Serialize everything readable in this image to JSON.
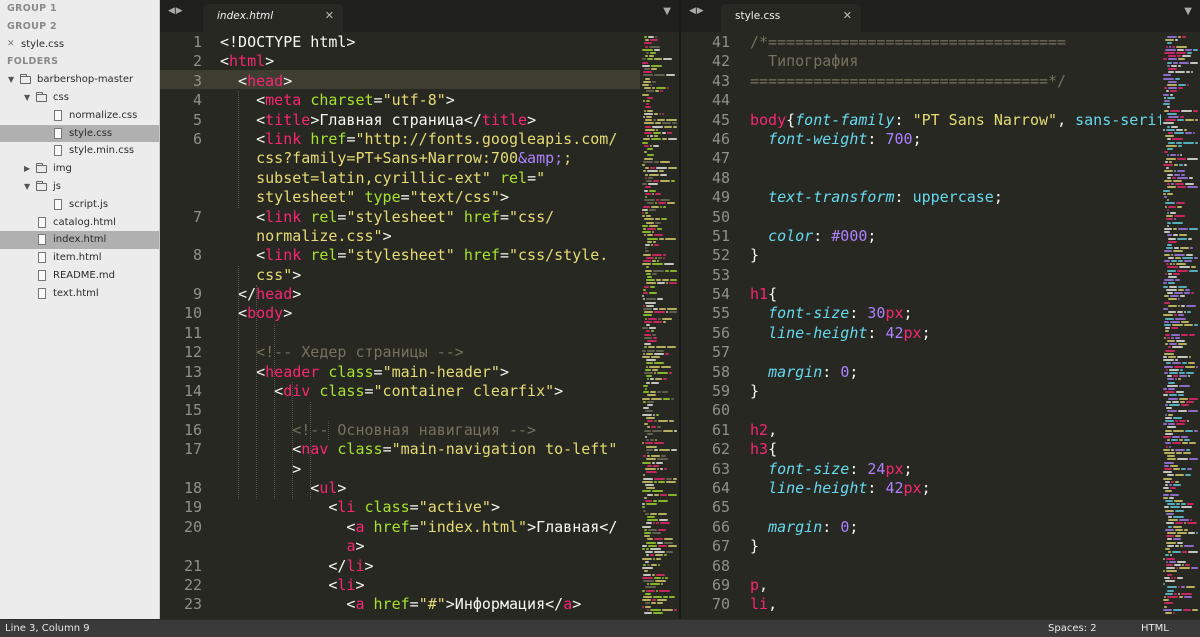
{
  "sidebar": {
    "group1": "GROUP 1",
    "group2": "GROUP 2",
    "open_file": "style.css",
    "folders": "FOLDERS",
    "tree": [
      {
        "label": "barbershop-master",
        "kind": "folder",
        "open": true,
        "depth": 0,
        "selected": false
      },
      {
        "label": "css",
        "kind": "folder",
        "open": true,
        "depth": 1,
        "selected": false
      },
      {
        "label": "normalize.css",
        "kind": "file",
        "depth": 2,
        "selected": false
      },
      {
        "label": "style.css",
        "kind": "file",
        "depth": 2,
        "selected": true
      },
      {
        "label": "style.min.css",
        "kind": "file",
        "depth": 2,
        "selected": false
      },
      {
        "label": "img",
        "kind": "folder",
        "open": false,
        "depth": 1,
        "selected": false
      },
      {
        "label": "js",
        "kind": "folder",
        "open": true,
        "depth": 1,
        "selected": false
      },
      {
        "label": "script.js",
        "kind": "file",
        "depth": 2,
        "selected": false
      },
      {
        "label": "catalog.html",
        "kind": "file",
        "depth": 1,
        "selected": false
      },
      {
        "label": "index.html",
        "kind": "file",
        "depth": 1,
        "selected": true
      },
      {
        "label": "item.html",
        "kind": "file",
        "depth": 1,
        "selected": false
      },
      {
        "label": "README.md",
        "kind": "file",
        "depth": 1,
        "selected": false
      },
      {
        "label": "text.html",
        "kind": "file",
        "depth": 1,
        "selected": false
      }
    ]
  },
  "left_pane": {
    "tab": "index.html",
    "lines": [
      {
        "n": "1",
        "segs": [
          [
            "",
            "<!DOCTYPE html>"
          ]
        ]
      },
      {
        "n": "2",
        "segs": [
          [
            "",
            "<"
          ],
          [
            "t",
            "html"
          ],
          [
            "",
            ">"
          ]
        ]
      },
      {
        "n": "3",
        "segs": [
          [
            "",
            "  <"
          ],
          [
            "t",
            "head"
          ],
          [
            "",
            ">"
          ]
        ]
      },
      {
        "n": "4",
        "segs": [
          [
            "",
            "    <"
          ],
          [
            "t",
            "meta"
          ],
          [
            "",
            " "
          ],
          [
            "a",
            "charset"
          ],
          [
            "",
            "="
          ],
          [
            "s",
            "\"utf-8\""
          ],
          [
            "",
            ">"
          ]
        ]
      },
      {
        "n": "5",
        "segs": [
          [
            "",
            "    <"
          ],
          [
            "t",
            "title"
          ],
          [
            "",
            ">Главная страница</"
          ],
          [
            "t",
            "title"
          ],
          [
            "",
            ">"
          ]
        ]
      },
      {
        "n": "6",
        "segs": [
          [
            "",
            "    <"
          ],
          [
            "t",
            "link"
          ],
          [
            "",
            " "
          ],
          [
            "a",
            "href"
          ],
          [
            "",
            "="
          ],
          [
            "s",
            "\"http://fonts.googleapis.com/"
          ]
        ]
      },
      {
        "n": "",
        "segs": [
          [
            "s",
            "    css?family=PT+Sans+Narrow:700"
          ],
          [
            "n",
            "&amp;"
          ],
          [
            "s",
            ";"
          ]
        ]
      },
      {
        "n": "",
        "segs": [
          [
            "s",
            "    subset=latin,cyrillic-ext\""
          ],
          [
            "",
            " "
          ],
          [
            "a",
            "rel"
          ],
          [
            "",
            "="
          ],
          [
            "s",
            "\""
          ]
        ]
      },
      {
        "n": "",
        "segs": [
          [
            "s",
            "    stylesheet\""
          ],
          [
            "",
            " "
          ],
          [
            "a",
            "type"
          ],
          [
            "",
            "="
          ],
          [
            "s",
            "\"text/css\""
          ],
          [
            "",
            ">"
          ]
        ]
      },
      {
        "n": "7",
        "segs": [
          [
            "",
            "    <"
          ],
          [
            "t",
            "link"
          ],
          [
            "",
            " "
          ],
          [
            "a",
            "rel"
          ],
          [
            "",
            "="
          ],
          [
            "s",
            "\"stylesheet\""
          ],
          [
            "",
            " "
          ],
          [
            "a",
            "href"
          ],
          [
            "",
            "="
          ],
          [
            "s",
            "\"css/"
          ]
        ]
      },
      {
        "n": "",
        "segs": [
          [
            "s",
            "    normalize.css\""
          ],
          [
            "",
            ">"
          ]
        ]
      },
      {
        "n": "8",
        "segs": [
          [
            "",
            "    <"
          ],
          [
            "t",
            "link"
          ],
          [
            "",
            " "
          ],
          [
            "a",
            "rel"
          ],
          [
            "",
            "="
          ],
          [
            "s",
            "\"stylesheet\""
          ],
          [
            "",
            " "
          ],
          [
            "a",
            "href"
          ],
          [
            "",
            "="
          ],
          [
            "s",
            "\"css/style."
          ]
        ]
      },
      {
        "n": "",
        "segs": [
          [
            "s",
            "    css\""
          ],
          [
            "",
            ">"
          ]
        ]
      },
      {
        "n": "9",
        "segs": [
          [
            "",
            "  </"
          ],
          [
            "t",
            "head"
          ],
          [
            "",
            ">"
          ]
        ]
      },
      {
        "n": "10",
        "segs": [
          [
            "",
            "  <"
          ],
          [
            "t",
            "body"
          ],
          [
            "",
            ">"
          ]
        ]
      },
      {
        "n": "11",
        "segs": [
          [
            "",
            ""
          ]
        ]
      },
      {
        "n": "12",
        "segs": [
          [
            "",
            "    "
          ],
          [
            "c",
            "<!-- Хедер страницы -->"
          ]
        ]
      },
      {
        "n": "13",
        "segs": [
          [
            "",
            "    <"
          ],
          [
            "t",
            "header"
          ],
          [
            "",
            " "
          ],
          [
            "a",
            "class"
          ],
          [
            "",
            "="
          ],
          [
            "s",
            "\"main-header\""
          ],
          [
            "",
            ">"
          ]
        ]
      },
      {
        "n": "14",
        "segs": [
          [
            "",
            "      <"
          ],
          [
            "t",
            "div"
          ],
          [
            "",
            " "
          ],
          [
            "a",
            "class"
          ],
          [
            "",
            "="
          ],
          [
            "s",
            "\"container clearfix\""
          ],
          [
            "",
            ">"
          ]
        ]
      },
      {
        "n": "15",
        "segs": [
          [
            "",
            ""
          ]
        ]
      },
      {
        "n": "16",
        "segs": [
          [
            "",
            "        "
          ],
          [
            "c",
            "<!-- Основная навигация -->"
          ]
        ]
      },
      {
        "n": "17",
        "segs": [
          [
            "",
            "        <"
          ],
          [
            "t",
            "nav"
          ],
          [
            "",
            " "
          ],
          [
            "a",
            "class"
          ],
          [
            "",
            "="
          ],
          [
            "s",
            "\"main-navigation to-left\""
          ]
        ]
      },
      {
        "n": "",
        "segs": [
          [
            "",
            "        >"
          ]
        ]
      },
      {
        "n": "18",
        "segs": [
          [
            "",
            "          <"
          ],
          [
            "t",
            "ul"
          ],
          [
            "",
            ">"
          ]
        ]
      },
      {
        "n": "19",
        "segs": [
          [
            "",
            "            <"
          ],
          [
            "t",
            "li"
          ],
          [
            "",
            " "
          ],
          [
            "a",
            "class"
          ],
          [
            "",
            "="
          ],
          [
            "s",
            "\"active\""
          ],
          [
            "",
            ">"
          ]
        ]
      },
      {
        "n": "20",
        "segs": [
          [
            "",
            "              <"
          ],
          [
            "t",
            "a"
          ],
          [
            "",
            " "
          ],
          [
            "a",
            "href"
          ],
          [
            "",
            "="
          ],
          [
            "s",
            "\"index.html\""
          ],
          [
            "",
            ">Главная</"
          ]
        ]
      },
      {
        "n": "",
        "segs": [
          [
            "",
            "              "
          ],
          [
            "t",
            "a"
          ],
          [
            "",
            ">"
          ]
        ]
      },
      {
        "n": "21",
        "segs": [
          [
            "",
            "            </"
          ],
          [
            "t",
            "li"
          ],
          [
            "",
            ">"
          ]
        ]
      },
      {
        "n": "22",
        "segs": [
          [
            "",
            "            <"
          ],
          [
            "t",
            "li"
          ],
          [
            "",
            ">"
          ]
        ]
      },
      {
        "n": "23",
        "segs": [
          [
            "",
            "              <"
          ],
          [
            "t",
            "a"
          ],
          [
            "",
            " "
          ],
          [
            "a",
            "href"
          ],
          [
            "",
            "="
          ],
          [
            "s",
            "\"#\""
          ],
          [
            "",
            ">Информация</"
          ],
          [
            "t",
            "a"
          ],
          [
            "",
            ">"
          ]
        ]
      }
    ]
  },
  "right_pane": {
    "tab": "style.css",
    "lines": [
      {
        "n": "41",
        "segs": [
          [
            "c",
            "/*================================="
          ]
        ]
      },
      {
        "n": "42",
        "segs": [
          [
            "c",
            "  Типография"
          ]
        ]
      },
      {
        "n": "43",
        "segs": [
          [
            "c",
            "=================================*/"
          ]
        ]
      },
      {
        "n": "44",
        "segs": [
          [
            "",
            ""
          ]
        ]
      },
      {
        "n": "45",
        "segs": [
          [
            "t",
            "body"
          ],
          [
            "",
            "{"
          ],
          [
            "p",
            "font-family"
          ],
          [
            "",
            ": "
          ],
          [
            "s",
            "\"PT Sans Narrow\""
          ],
          [
            "",
            ", "
          ],
          [
            "k",
            "sans-serif"
          ]
        ]
      },
      {
        "n": "46",
        "segs": [
          [
            "",
            "  "
          ],
          [
            "p",
            "font-weight"
          ],
          [
            "",
            ": "
          ],
          [
            "n",
            "700"
          ],
          [
            "",
            ";"
          ]
        ]
      },
      {
        "n": "47",
        "segs": [
          [
            "",
            ""
          ]
        ]
      },
      {
        "n": "48",
        "segs": [
          [
            "",
            ""
          ]
        ]
      },
      {
        "n": "49",
        "segs": [
          [
            "",
            "  "
          ],
          [
            "p",
            "text-transform"
          ],
          [
            "",
            ": "
          ],
          [
            "k",
            "uppercase"
          ],
          [
            "",
            ";"
          ]
        ]
      },
      {
        "n": "50",
        "segs": [
          [
            "",
            ""
          ]
        ]
      },
      {
        "n": "51",
        "segs": [
          [
            "",
            "  "
          ],
          [
            "p",
            "color"
          ],
          [
            "",
            ": "
          ],
          [
            "n",
            "#000"
          ],
          [
            "",
            ";"
          ]
        ]
      },
      {
        "n": "52",
        "segs": [
          [
            "",
            "}"
          ]
        ]
      },
      {
        "n": "53",
        "segs": [
          [
            "",
            ""
          ]
        ]
      },
      {
        "n": "54",
        "segs": [
          [
            "t",
            "h1"
          ],
          [
            "",
            "{"
          ]
        ]
      },
      {
        "n": "55",
        "segs": [
          [
            "",
            "  "
          ],
          [
            "p",
            "font-size"
          ],
          [
            "",
            ": "
          ],
          [
            "n",
            "30"
          ],
          [
            "t",
            "px"
          ],
          [
            "",
            ";"
          ]
        ]
      },
      {
        "n": "56",
        "segs": [
          [
            "",
            "  "
          ],
          [
            "p",
            "line-height"
          ],
          [
            "",
            ": "
          ],
          [
            "n",
            "42"
          ],
          [
            "t",
            "px"
          ],
          [
            "",
            ";"
          ]
        ]
      },
      {
        "n": "57",
        "segs": [
          [
            "",
            ""
          ]
        ]
      },
      {
        "n": "58",
        "segs": [
          [
            "",
            "  "
          ],
          [
            "p",
            "margin"
          ],
          [
            "",
            ": "
          ],
          [
            "n",
            "0"
          ],
          [
            "",
            ";"
          ]
        ]
      },
      {
        "n": "59",
        "segs": [
          [
            "",
            "}"
          ]
        ]
      },
      {
        "n": "60",
        "segs": [
          [
            "",
            ""
          ]
        ]
      },
      {
        "n": "61",
        "segs": [
          [
            "t",
            "h2"
          ],
          [
            "",
            ","
          ]
        ]
      },
      {
        "n": "62",
        "segs": [
          [
            "t",
            "h3"
          ],
          [
            "",
            "{"
          ]
        ]
      },
      {
        "n": "63",
        "segs": [
          [
            "",
            "  "
          ],
          [
            "p",
            "font-size"
          ],
          [
            "",
            ": "
          ],
          [
            "n",
            "24"
          ],
          [
            "t",
            "px"
          ],
          [
            "",
            ";"
          ]
        ]
      },
      {
        "n": "64",
        "segs": [
          [
            "",
            "  "
          ],
          [
            "p",
            "line-height"
          ],
          [
            "",
            ": "
          ],
          [
            "n",
            "42"
          ],
          [
            "t",
            "px"
          ],
          [
            "",
            ";"
          ]
        ]
      },
      {
        "n": "65",
        "segs": [
          [
            "",
            ""
          ]
        ]
      },
      {
        "n": "66",
        "segs": [
          [
            "",
            "  "
          ],
          [
            "p",
            "margin"
          ],
          [
            "",
            ": "
          ],
          [
            "n",
            "0"
          ],
          [
            "",
            ";"
          ]
        ]
      },
      {
        "n": "67",
        "segs": [
          [
            "",
            "}"
          ]
        ]
      },
      {
        "n": "68",
        "segs": [
          [
            "",
            ""
          ]
        ]
      },
      {
        "n": "69",
        "segs": [
          [
            "t",
            "p"
          ],
          [
            "",
            ","
          ]
        ]
      },
      {
        "n": "70",
        "segs": [
          [
            "t",
            "li"
          ],
          [
            "",
            ","
          ]
        ]
      }
    ]
  },
  "status": {
    "position": "Line 3, Column 9",
    "indent": "Spaces: 2",
    "syntax": "HTML"
  },
  "colors": {
    "editor_bg": "#272822",
    "tag": "#f92672",
    "attr": "#a6e22e",
    "string": "#e6db74",
    "comment": "#75715e",
    "property": "#66d9ef",
    "number": "#ae81ff"
  }
}
